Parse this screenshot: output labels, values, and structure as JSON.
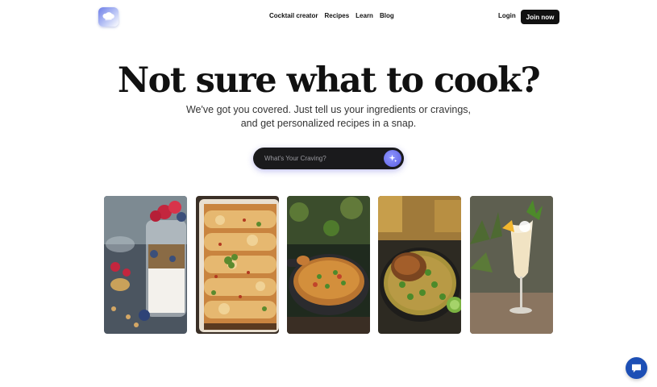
{
  "header": {
    "logo_alt": "chef hat logo",
    "nav": [
      {
        "label": "Cocktail creator"
      },
      {
        "label": "Recipes"
      },
      {
        "label": "Learn"
      },
      {
        "label": "Blog"
      }
    ],
    "login_label": "Login",
    "join_label": "Join now"
  },
  "hero": {
    "title": "Not sure what to cook?",
    "subtitle_line1": "We've got you covered. Just tell us your ingredients or cravings,",
    "subtitle_line2": "and get personalized recipes in a snap."
  },
  "search": {
    "placeholder": "What's Your Craving?",
    "value": "",
    "button_icon": "sparkle-icon"
  },
  "gallery": [
    {
      "icon": "yogurt-parfait-image"
    },
    {
      "icon": "enchiladas-image"
    },
    {
      "icon": "curry-skillet-image"
    },
    {
      "icon": "chicken-rice-image"
    },
    {
      "icon": "pina-colada-image"
    }
  ],
  "chat_widget": {
    "icon": "chat-icon"
  },
  "colors": {
    "accent": "#6f73ee",
    "dark": "#111111",
    "chat": "#1d4fb5"
  }
}
